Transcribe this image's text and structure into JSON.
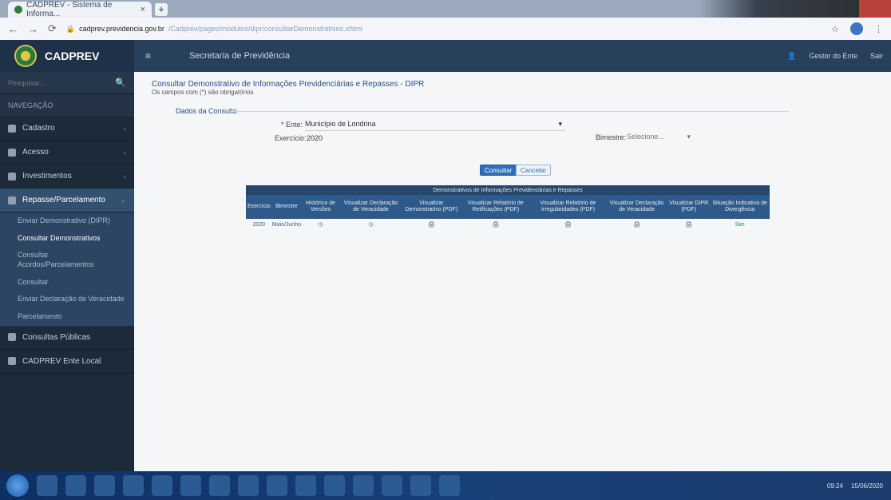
{
  "browser": {
    "tab_title": "CADPREV - Sistema de Informa...",
    "tab_close": "×",
    "new_tab": "+",
    "url_host": "cadprev.previdencia.gov.br",
    "url_path": "/Cadprev/pages/modulos/dipr/consultarDemonstrativos.xhtml"
  },
  "app": {
    "name": "CADPREV",
    "menu_toggle": "≡",
    "secretaria": "Secretaria de Previdência",
    "user": "Gestor do Ente",
    "logout": "Sair"
  },
  "sidebar": {
    "search_placeholder": "Pesquisar...",
    "search_icon": "search-icon",
    "header": "NAVEGAÇÃO",
    "items": [
      {
        "label": "Cadastro",
        "icon": "user-icon"
      },
      {
        "label": "Acesso",
        "icon": "lock-icon"
      },
      {
        "label": "Investimentos",
        "icon": "chart-icon"
      },
      {
        "label": "Repasse/Parcelamento",
        "icon": "money-icon"
      }
    ],
    "subitems": [
      "Enviar Demonstrativo (DIPR)",
      "Consultar Demonstrativos",
      "Consultar Acordos/Parcelamentos",
      "Consultar",
      "Enviar Declaração de Veracidade",
      "Parcelamento"
    ],
    "items_bottom": [
      {
        "label": "Consultas Públicas",
        "icon": "users-icon"
      },
      {
        "label": "CADPREV Ente Local",
        "icon": "monitor-icon"
      }
    ]
  },
  "main": {
    "title": "Consultar Demonstrativo de Informações Previdenciárias e Repasses - DIPR",
    "subtitle": "Os campos com (*) são obrigatórios",
    "section": "Dados da Consulta",
    "ente_label": "* Ente:",
    "ente_value": "Município de Londrina",
    "exercicio_label": "Exercício:",
    "exercicio_value": "2020",
    "bimestre_label": "Bimestre:",
    "bimestre_value": "Selecione...",
    "btn_consultar": "Consultar",
    "btn_cancelar": "Cancelar"
  },
  "table": {
    "caption": "Demonstrativos de Informações Previdenciárias e Repasses",
    "headers": [
      "Exercício",
      "Bimestre",
      "Histórico de Versões",
      "Visualizar Declaração de Veracidade",
      "Visualizar Demonstrativo (PDF)",
      "Visualizar Relatório de Retificações (PDF)",
      "Visualizar Relatório de Irregularidades (PDF)",
      "Visualizar Declaração de Veracidade",
      "Visualizar DIPR (PDF)",
      "Situação Indicativa de Divergência"
    ],
    "rows": [
      [
        "2020",
        "Maio/Junho",
        "◷",
        "◷",
        "🖨",
        "🖨",
        "🖨",
        "🖨",
        "🖨",
        "Sim"
      ]
    ]
  },
  "taskbar": {
    "clock": "09:24",
    "date": "15/06/2020"
  },
  "colors": {
    "header_bg": "#29405d",
    "sidebar_bg": "#1d2a3a",
    "accent": "#2f6fb7",
    "active_nav": "#33506f"
  }
}
